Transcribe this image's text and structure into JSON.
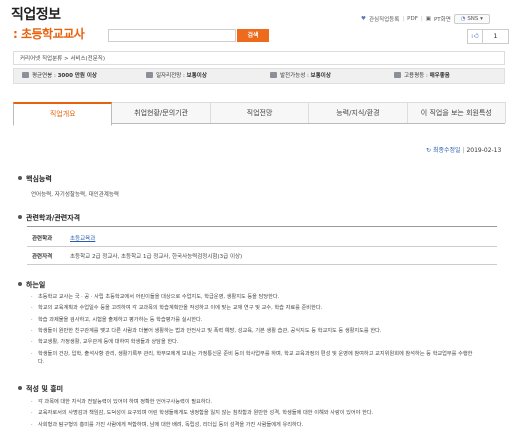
{
  "header": {
    "title": "직업정보",
    "job_name": ": 초등학교교사",
    "search_placeholder": "",
    "search_button": "검색",
    "tools": {
      "favorite": "관심직업등록",
      "pdf": "PDF",
      "print": "PT화면",
      "sns": "SNS"
    },
    "like_count": "1"
  },
  "breadcrumb": "커리어넷 직업분류 > 서비스(전문직)",
  "info_bar": [
    {
      "label": "평균연봉",
      "value": "3000 만원 이상",
      "icon": "money-icon"
    },
    {
      "label": "일자리전망",
      "value": "보통이상",
      "icon": "chart-icon"
    },
    {
      "label": "발전가능성",
      "value": "보통이상",
      "icon": "growth-icon"
    },
    {
      "label": "고용평등",
      "value": "매우좋음",
      "icon": "people-icon"
    }
  ],
  "tabs": [
    "직업개요",
    "취업현황/문의기관",
    "직업전망",
    "능력/지식/환경",
    "이 직업을 보는 회원특성"
  ],
  "update": {
    "label": "최종수정일",
    "date": "2019-02-13"
  },
  "sections": {
    "core_ability": {
      "title": "핵심능력",
      "text": "언어능력, 자기성찰능력, 대인관계능력"
    },
    "related": {
      "title": "관련학과/관련자격",
      "rows": [
        {
          "label": "관련학과",
          "value": "초등교육과"
        },
        {
          "label": "관련자격",
          "value": "초등학교 2급 정교사, 초등학교 1급 정교사, 한국사능력검정시험(3급 이상)"
        }
      ]
    },
    "duties": {
      "title": "하는일",
      "items": [
        "초등학교 교사는 국 · 공 · 사립 초등학교에서 어린이들을 대상으로 수업지도, 학급운영, 생활지도 등을 담당한다.",
        "학교의 교육계획과 수업일수 등을 고려하여 각 교과목의 학습계획안을 작성하고 이에 맞는 교재 연구 및 교수, 학습 자료를 준비한다.",
        "학습 과제물을 검사하고, 시험을 출제하고 평가하는 등 학습평가를 실시한다.",
        "학생들이 원만한 친구관계를 맺고 다른 사람과 더불어 생활하는 법과 안전사고 및 폭력 예방, 성교육, 기본 생활 습관, 공식지도 등 학교지도 등 생활지도를 한다.",
        "학교생활, 가정생활, 교우관계 등에 대하여 학생들과 상담을 한다.",
        "학생들의 건강, 입학, 출석사항 관리, 생활기록부 관리, 학부모에게 보내는 가정통신문 준비 등의 학사업무를 하며, 학교 교육과정의 편성 및 운영에 참여하고 교지위원회에 참석하는 등 학교업무를 수행한다."
      ]
    },
    "aptitude": {
      "title": "적성 및 흥미",
      "items": [
        "각 과목에 대한 지식과 전달능력이 있어야 하며 정확한 언어구사능력이 필요하다.",
        "교육자로서의 사명감과 책임감, 도덕성이 요구되며 어린 학생들에게도 냉정함을 잃지 않는 침착함과 원만한 성격, 학생들에 대한 이해와 사랑이 있어야 한다.",
        "사회형과 탐구형의 흥미를 가진 사람에게 적합하며, 남에 대한 배려, 독립성, 리더십 등의 성격을 가진 사람들에게 유리하다."
      ]
    }
  }
}
